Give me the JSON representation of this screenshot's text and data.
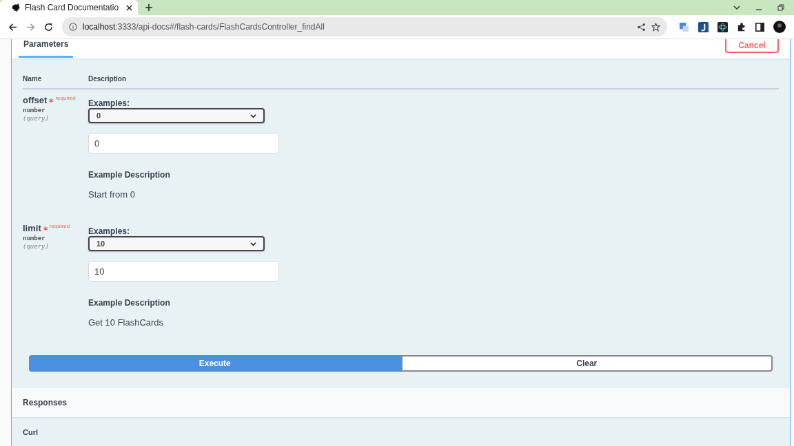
{
  "browser": {
    "tab_title": "Flash Card Documentatio",
    "url_host": "localhost",
    "url_path": ":3333/api-docs#/flash-cards/FlashCardsController_findAll"
  },
  "section": {
    "tab": "Parameters",
    "cancel": "Cancel"
  },
  "table": {
    "columns": [
      "Name",
      "Description"
    ],
    "params": [
      {
        "name": "offset",
        "required": true,
        "required_label": "required",
        "type": "number",
        "in": "(query)",
        "examples_label": "Examples:",
        "example": "0",
        "value": "0",
        "desc_label": "Example Description",
        "desc": "Start from 0"
      },
      {
        "name": "limit",
        "required": true,
        "required_label": "required",
        "type": "number",
        "in": "(query)",
        "examples_label": "Examples:",
        "example": "10",
        "value": "10",
        "desc_label": "Example Description",
        "desc": "Get 10 FlashCards"
      }
    ]
  },
  "buttons": {
    "execute": "Execute",
    "clear": "Clear"
  },
  "responses": {
    "title": "Responses",
    "curl": "Curl"
  }
}
